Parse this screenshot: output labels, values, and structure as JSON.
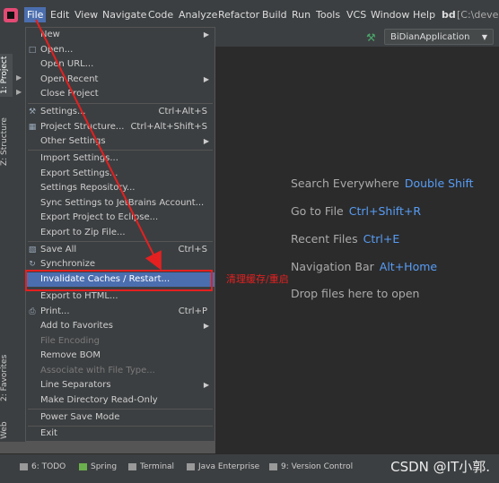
{
  "menubar": {
    "items": [
      "File",
      "Edit",
      "View",
      "Navigate",
      "Code",
      "Analyze",
      "Refactor",
      "Build",
      "Run",
      "Tools",
      "VCS",
      "Window",
      "Help"
    ],
    "project_label": "bd",
    "path": "[C:\\develop"
  },
  "toolbar": {
    "run_config": "BiDianApplication"
  },
  "left_tabs": {
    "project": "1: Project",
    "structure": "Z: Structure",
    "favorites": "2: Favorites",
    "web": "Web"
  },
  "file_menu": {
    "new": "New",
    "open": "Open...",
    "open_url": "Open URL...",
    "open_recent": "Open Recent",
    "close_project": "Close Project",
    "settings": "Settings...",
    "settings_shortcut": "Ctrl+Alt+S",
    "project_structure": "Project Structure...",
    "project_structure_shortcut": "Ctrl+Alt+Shift+S",
    "other_settings": "Other Settings",
    "import_settings": "Import Settings...",
    "export_settings": "Export Settings...",
    "settings_repository": "Settings Repository...",
    "sync_settings": "Sync Settings to JetBrains Account...",
    "export_eclipse": "Export Project to Eclipse...",
    "export_zip": "Export to Zip File...",
    "save_all": "Save All",
    "save_all_shortcut": "Ctrl+S",
    "synchronize": "Synchronize",
    "invalidate": "Invalidate Caches / Restart...",
    "export_html": "Export to HTML...",
    "print": "Print...",
    "print_shortcut": "Ctrl+P",
    "add_favorites": "Add to Favorites",
    "file_encoding": "File Encoding",
    "remove_bom": "Remove BOM",
    "associate_file_type": "Associate with File Type...",
    "line_separators": "Line Separators",
    "make_read_only": "Make Directory Read-Only",
    "power_save": "Power Save Mode",
    "exit": "Exit"
  },
  "editor_hints": [
    {
      "label": "Search Everywhere",
      "key": "Double Shift"
    },
    {
      "label": "Go to File",
      "key": "Ctrl+Shift+R"
    },
    {
      "label": "Recent Files",
      "key": "Ctrl+E"
    },
    {
      "label": "Navigation Bar",
      "key": "Alt+Home"
    },
    {
      "label": "Drop files here to open",
      "key": ""
    }
  ],
  "bottom_tabs": [
    "6: TODO",
    "Spring",
    "Terminal",
    "Java Enterprise",
    "9: Version Control"
  ],
  "annotation": {
    "note": "清理缓存/重启",
    "color": "#e52020"
  },
  "watermark": "CSDN @IT小郭.",
  "colors": {
    "highlight": "#4b6eaf",
    "key": "#589df6",
    "bg": "#2b2b2b",
    "panel": "#3c3f41"
  }
}
